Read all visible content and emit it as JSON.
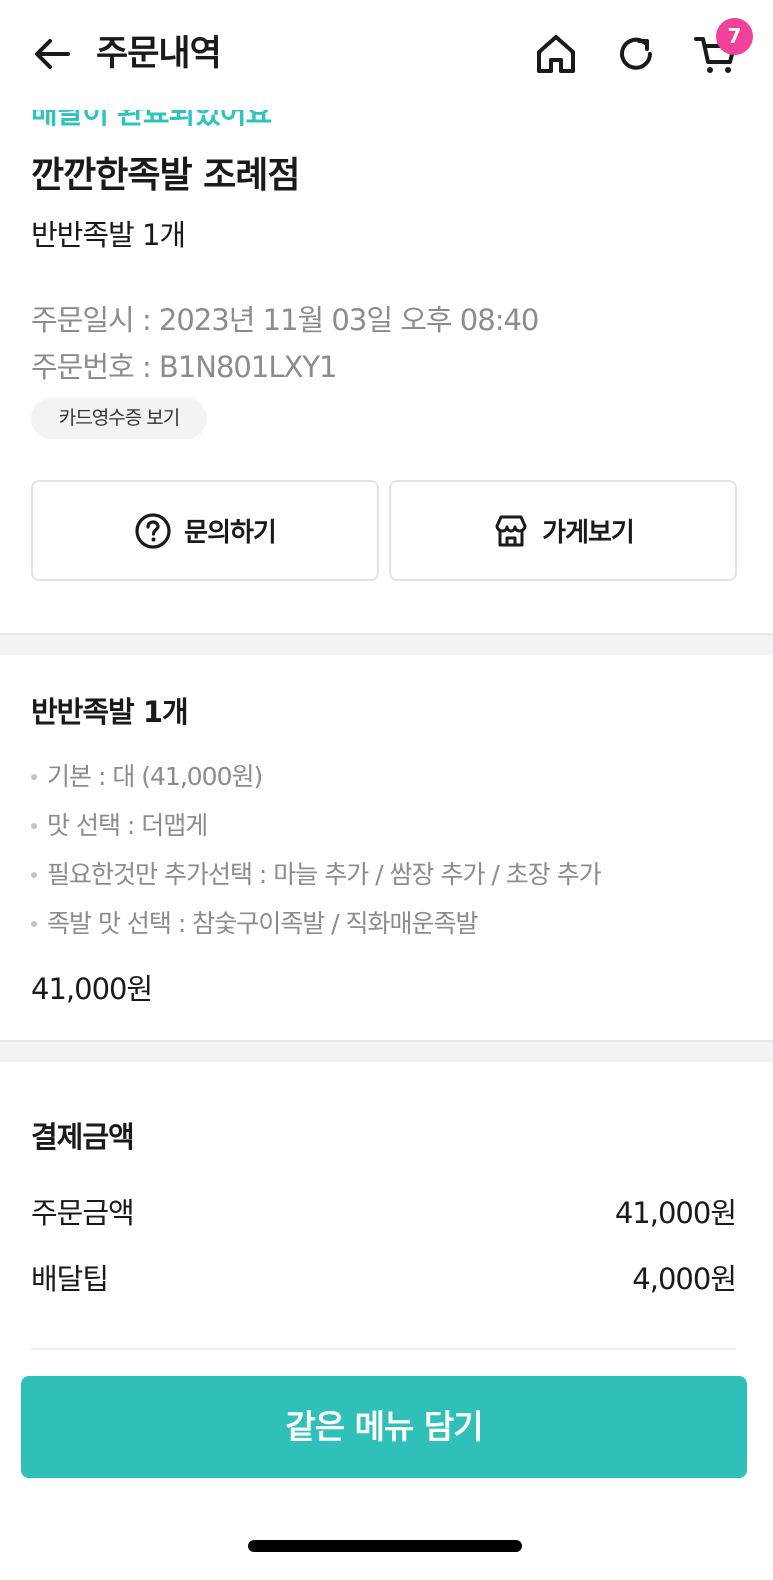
{
  "header": {
    "title": "주문내역",
    "cart_count": "7",
    "back_icon": "back-arrow-icon",
    "home_icon": "home-icon",
    "refresh_icon": "refresh-icon",
    "cart_icon": "cart-icon"
  },
  "order": {
    "status": "배달이 완료되었어요",
    "store_name": "깐깐한족발 조례점",
    "item_summary": "반반족발 1개",
    "date": "주문일시 : 2023년 11월 03일 오후 08:40",
    "number": "주문번호 : B1N801LXY1",
    "receipt_button": "카드영수증 보기"
  },
  "actions": {
    "inquiry": "문의하기",
    "store": "가게보기"
  },
  "menu": {
    "title": "반반족발 1개",
    "options": [
      "기본 : 대 (41,000원)",
      "맛 선택 : 더맵게",
      "필요한것만 추가선택 : 마늘 추가 / 쌈장 추가 / 초장 추가",
      "족발 맛 선택 : 참숯구이족발 / 직화매운족발"
    ],
    "price": "41,000원"
  },
  "payment": {
    "title": "결제금액",
    "rows": [
      {
        "label": "주문금액",
        "value": "41,000원"
      },
      {
        "label": "배달팁",
        "value": "4,000원"
      }
    ]
  },
  "reorder_button": "같은 메뉴 담기",
  "colors": {
    "accent": "#2ec0b9",
    "badge": "#f0419b",
    "muted_text": "#8c8c8c"
  }
}
